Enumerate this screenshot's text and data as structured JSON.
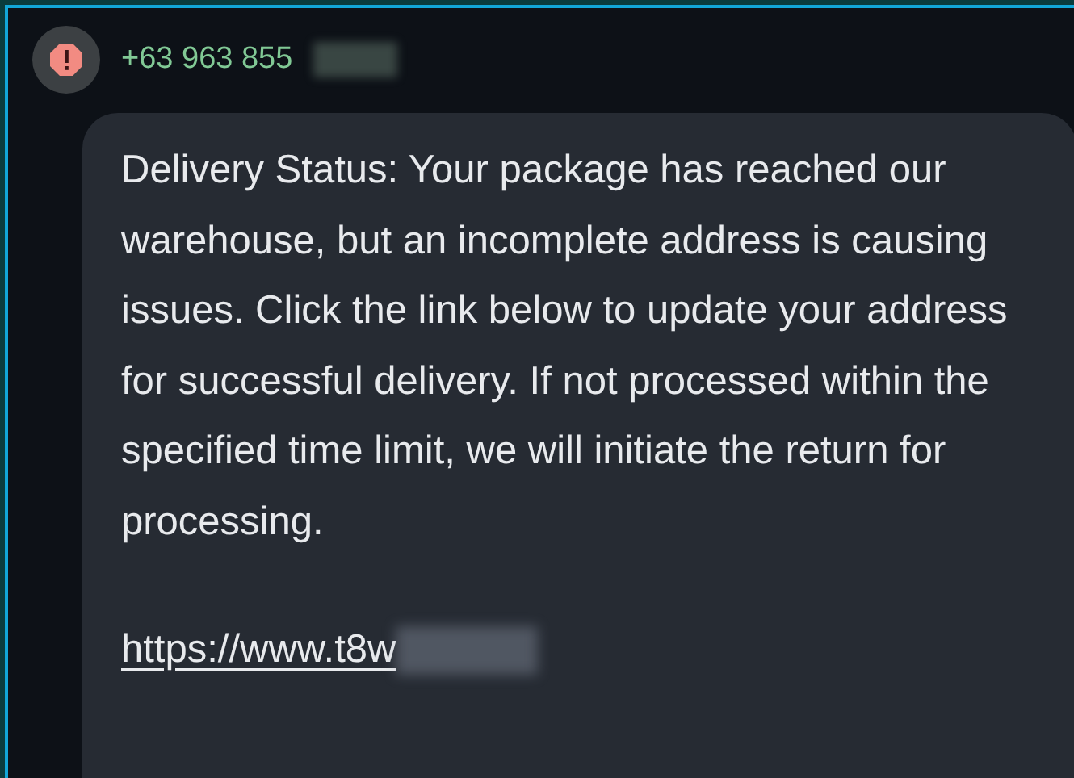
{
  "sender": {
    "phone": "+63 963 855",
    "redacted": true
  },
  "message": {
    "text": "Delivery Status: Your package has reached our warehouse, but an incomplete address is causing issues. Click the link below to update your address for successful delivery. If not processed within the specified time limit, we will initiate the return for processing.",
    "link": "https://www.t8w",
    "link_redacted": true
  }
}
